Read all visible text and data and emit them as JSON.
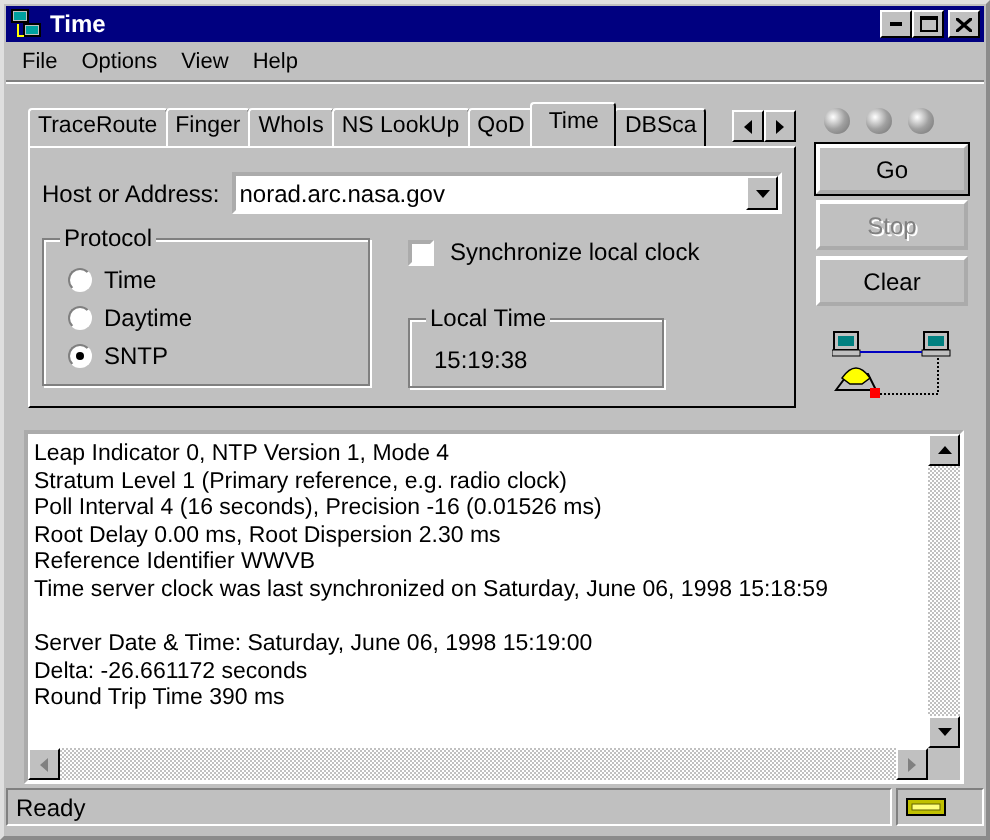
{
  "window": {
    "title": "Time"
  },
  "menu": [
    {
      "label": "File"
    },
    {
      "label": "Options"
    },
    {
      "label": "View"
    },
    {
      "label": "Help"
    }
  ],
  "tabs": [
    {
      "label": "TraceRoute",
      "selected": false
    },
    {
      "label": "Finger",
      "selected": false
    },
    {
      "label": "WhoIs",
      "selected": false
    },
    {
      "label": "NS LookUp",
      "selected": false
    },
    {
      "label": "QoD",
      "selected": false
    },
    {
      "label": "Time",
      "selected": true
    },
    {
      "label": "DBSca",
      "selected": false
    }
  ],
  "host": {
    "label": "Host or Address:",
    "value": "norad.arc.nasa.gov"
  },
  "protocol": {
    "title": "Protocol",
    "options": [
      {
        "label": "Time",
        "selected": false
      },
      {
        "label": "Daytime",
        "selected": false
      },
      {
        "label": "SNTP",
        "selected": true
      }
    ]
  },
  "sync_checkbox": {
    "label": "Synchronize local clock",
    "checked": false
  },
  "local_time": {
    "title": "Local Time",
    "value": "15:19:38"
  },
  "buttons": [
    {
      "label": "Go",
      "disabled": false,
      "default": true
    },
    {
      "label": "Stop",
      "disabled": true,
      "default": false
    },
    {
      "label": "Clear",
      "disabled": false,
      "default": false
    }
  ],
  "output": [
    {
      "lines": [
        "Leap Indicator 0, NTP Version 1, Mode 4",
        "Stratum Level 1 (Primary reference, e.g. radio clock)",
        "Poll Interval 4 (16 seconds), Precision -16 (0.01526 ms)",
        "Root Delay 0.00 ms, Root Dispersion 2.30 ms",
        "Reference Identifier WWVB",
        "Time server clock was last synchronized on Saturday, June 06, 1998 15:18:59"
      ]
    },
    {
      "lines": [
        "Server Date & Time: Saturday, June 06, 1998 15:19:00",
        "Delta: -26.661172 seconds",
        "Round Trip Time 390 ms"
      ]
    }
  ],
  "status_bar": {
    "text": "Ready"
  }
}
